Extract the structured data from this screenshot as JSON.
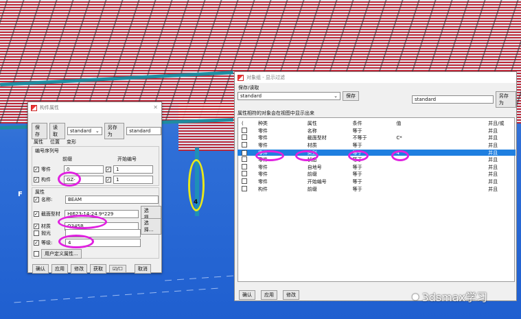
{
  "colors": {
    "selection": "#1f7fe0",
    "highlight_circle": "#e021e0",
    "yellow_circle": "#e8e81a"
  },
  "part_dialog": {
    "title": "构件属性",
    "save_btn": "保存",
    "read_btn": "读取",
    "preset": "standard",
    "save_as_btn": "另存为",
    "save_as_value": "standard",
    "tabs": [
      "属性",
      "位置",
      "变形"
    ],
    "numbering_group": "编号序列号",
    "col_prefix": "前缀",
    "col_start": "开始编号",
    "part_label": "零件",
    "part_prefix": "0",
    "part_start": "1",
    "assembly_label": "构件",
    "assembly_prefix": "GZ-",
    "assembly_start": "1",
    "attr_group": "属性",
    "name_label": "名称:",
    "name_value": "BEAM",
    "profile_label": "截面型材",
    "profile_value": "HI623-14-24.9*229",
    "profile_select": "选择...",
    "material_label": "材质",
    "material_value": "Q345B",
    "material_select": "选择...",
    "finish_label": "抛光",
    "finish_value": "",
    "class_label": "等级:",
    "class_value": "4",
    "udf_btn": "用户定义属性...",
    "bottom": {
      "ok": "确认",
      "apply": "应用",
      "modify": "修改",
      "get": "获取",
      "toggle": "☑/☐",
      "cancel": "取消"
    }
  },
  "filter_dialog": {
    "title": "对象组 - 显示过滤",
    "saveload_label": "保存/读取",
    "preset": "standard",
    "save_btn": "保存",
    "save_as_value": "standard",
    "save_as_btn": "另存为",
    "desc": "属性相符的对象会在视图中显示出来",
    "headers": [
      "(",
      "种类",
      "属性",
      "条件",
      "值",
      "并且/或"
    ],
    "rows": [
      {
        "checked": false,
        "kind": "零件",
        "attr": "名称",
        "cond": "等于",
        "value": "",
        "logic": "并且"
      },
      {
        "checked": false,
        "kind": "零件",
        "attr": "截面型材",
        "cond": "不等于",
        "value": "C*",
        "logic": "并且"
      },
      {
        "checked": false,
        "kind": "零件",
        "attr": "材质",
        "cond": "等于",
        "value": "",
        "logic": "并且"
      },
      {
        "checked": true,
        "kind": "零件",
        "attr": "类别",
        "cond": "等于",
        "value": "4",
        "logic": "并且"
      },
      {
        "checked": false,
        "kind": "零件",
        "attr": "状态",
        "cond": "等于",
        "value": "",
        "logic": "并且"
      },
      {
        "checked": false,
        "kind": "零件",
        "attr": "自地号",
        "cond": "等于",
        "value": "",
        "logic": "并且"
      },
      {
        "checked": false,
        "kind": "零件",
        "attr": "前缀",
        "cond": "等于",
        "value": "",
        "logic": "并且"
      },
      {
        "checked": false,
        "kind": "零件",
        "attr": "开始编号",
        "cond": "等于",
        "value": "",
        "logic": "并且"
      },
      {
        "checked": false,
        "kind": "构件",
        "attr": "前缀",
        "cond": "等于",
        "value": "",
        "logic": "并且"
      }
    ],
    "bottom": {
      "ok": "确认",
      "apply": "应用",
      "modify": "修改"
    }
  },
  "scene": {
    "left_marker": "F",
    "column_label": "4"
  },
  "watermark": "3dsmax学习"
}
